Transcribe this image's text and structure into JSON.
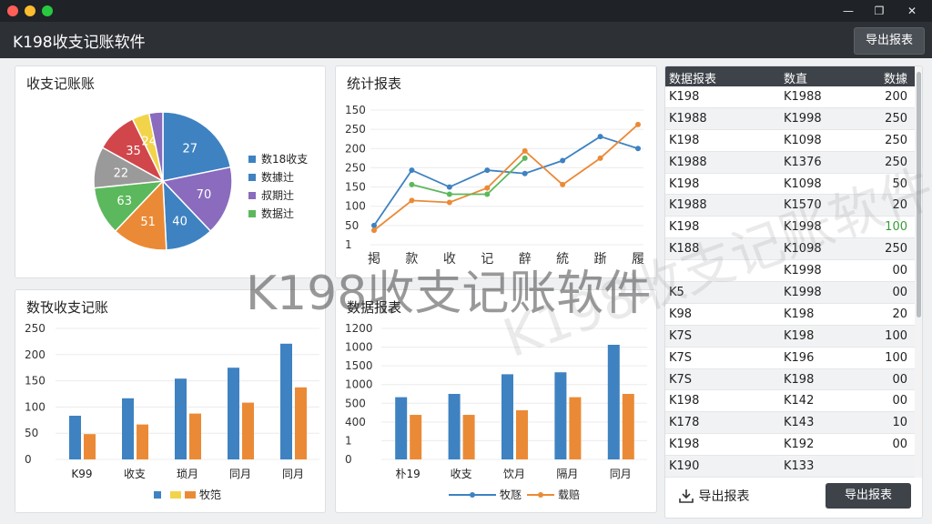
{
  "window": {
    "title": "K198收支记账软件",
    "export_top": "导出报表",
    "controls": {
      "minimize": "—",
      "maximize": "❐",
      "close": "✕"
    },
    "traffic_colors": [
      "#ff5f57",
      "#febc2e",
      "#28c840"
    ]
  },
  "colors": {
    "blue": "#3e82c1",
    "orange": "#eb8a36",
    "purple": "#8a6bbd",
    "green": "#5cb85c",
    "gray": "#9a9a9a",
    "red": "#d1464a",
    "yellow": "#f2d44a"
  },
  "pie": {
    "title": "收支记账账",
    "chart_data": {
      "type": "pie",
      "slices": [
        {
          "label": "27",
          "value": 27,
          "color": "#3e82c1"
        },
        {
          "label": "70",
          "value": 20,
          "color": "#8a6bbd"
        },
        {
          "label": "40",
          "value": 14,
          "color": "#3e82c1"
        },
        {
          "label": "51",
          "value": 16,
          "color": "#eb8a36"
        },
        {
          "label": "63",
          "value": 14,
          "color": "#5cb85c"
        },
        {
          "label": "22",
          "value": 12,
          "color": "#9a9a9a"
        },
        {
          "label": "35",
          "value": 12,
          "color": "#d1464a"
        },
        {
          "label": "24",
          "value": 5,
          "color": "#f2d44a"
        },
        {
          "label": "",
          "value": 4,
          "color": "#8a6bbd"
        }
      ]
    },
    "legend": [
      {
        "label": "数18收支",
        "color": "#3e82c1"
      },
      {
        "label": "数據辻",
        "color": "#3e82c1"
      },
      {
        "label": "叔期辻",
        "color": "#8a6bbd"
      },
      {
        "label": "数据辻",
        "color": "#5cb85c"
      }
    ]
  },
  "line": {
    "title": "统计报表",
    "chart_data": {
      "type": "line",
      "categories": [
        "掲",
        "款",
        "收",
        "记",
        "辪",
        "統",
        "䟷",
        "履"
      ],
      "yticks": [
        "150",
        "250",
        "200",
        "250",
        "150",
        "100",
        "50",
        "1"
      ],
      "ylim": [
        0,
        280
      ],
      "series": [
        {
          "values": [
            40,
            155,
            120,
            155,
            148,
            175,
            225,
            200
          ],
          "color": "#3e82c1"
        },
        {
          "values": [
            30,
            92,
            88,
            118,
            195,
            125,
            180,
            250
          ],
          "color": "#eb8a36"
        },
        {
          "values": [
            null,
            125,
            105,
            105,
            180,
            null,
            null,
            null
          ],
          "color": "#5cb85c"
        }
      ]
    }
  },
  "bar1": {
    "title": "数攼收支记账",
    "chart_data": {
      "type": "bar",
      "categories": [
        "K99",
        "收支",
        "琐月",
        "同月",
        "同月"
      ],
      "yticks": [
        "0",
        "50",
        "100",
        "150",
        "200",
        "250"
      ],
      "ylim": [
        0,
        300
      ],
      "series": [
        {
          "values": [
            100,
            140,
            185,
            210,
            265
          ],
          "color": "#3e82c1"
        },
        {
          "values": [
            58,
            80,
            105,
            130,
            165
          ],
          "color": "#eb8a36"
        }
      ]
    },
    "legend_text": "牧笵"
  },
  "bar2": {
    "title": "数据报表",
    "chart_data": {
      "type": "bar",
      "categories": [
        "朴19",
        "收支",
        "饮月",
        "隔月",
        "同月"
      ],
      "yticks": [
        "0",
        "1",
        "400",
        "500",
        "1000",
        "1500",
        "1000",
        "1200"
      ],
      "ylim": [
        0,
        2000
      ],
      "series": [
        {
          "values": [
            950,
            1000,
            1300,
            1330,
            1750
          ],
          "color": "#3e82c1"
        },
        {
          "values": [
            680,
            680,
            750,
            950,
            1000
          ],
          "color": "#eb8a36"
        }
      ]
    },
    "legend": [
      "牧豗",
      "载赔"
    ]
  },
  "table": {
    "headers": [
      "数据报表",
      "数直",
      "数據"
    ],
    "rows": [
      [
        "K198",
        "K1988",
        "200"
      ],
      [
        "K1988",
        "K1998",
        "250"
      ],
      [
        "K198",
        "K1098",
        "250"
      ],
      [
        "K1988",
        "K1376",
        "250"
      ],
      [
        "K198",
        "K1098",
        "50"
      ],
      [
        "K1988",
        "K1570",
        "20"
      ],
      [
        "K198",
        "K1998",
        "100"
      ],
      [
        "K188",
        "K1098",
        "250"
      ],
      [
        "",
        "K1998",
        "00"
      ],
      [
        "K5",
        "K1998",
        "00"
      ],
      [
        "K98",
        "K198",
        "20"
      ],
      [
        "K7S",
        "K198",
        "100"
      ],
      [
        "K7S",
        "K196",
        "100"
      ],
      [
        "K7S",
        "K198",
        "00"
      ],
      [
        "K198",
        "K142",
        "00"
      ],
      [
        "K178",
        "K143",
        "10"
      ],
      [
        "K198",
        "K192",
        "00"
      ],
      [
        "K190",
        "K133",
        ""
      ]
    ],
    "highlight_color": "#3a9a3a",
    "export_link": "导出报表",
    "export_button": "导出报表"
  },
  "watermark": "K198收支记账软件",
  "watermark2": "K198收支记账软件"
}
